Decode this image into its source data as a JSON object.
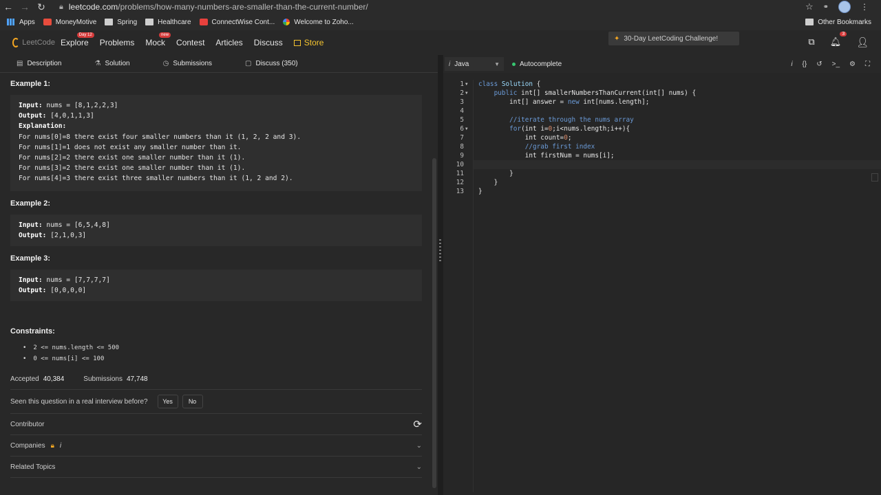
{
  "browser": {
    "url_host": "leetcode.com",
    "url_path": "/problems/how-many-numbers-are-smaller-than-the-current-number/",
    "bookmarks": [
      "Apps",
      "MoneyMotive",
      "Spring",
      "Healthcare",
      "ConnectWise Cont...",
      "Welcome to Zoho..."
    ],
    "other_bookmarks": "Other Bookmarks"
  },
  "nav": {
    "logo": "LeetCode",
    "items": [
      "Explore",
      "Problems",
      "Mock",
      "Contest",
      "Articles",
      "Discuss"
    ],
    "explore_badge": "Day 12",
    "mock_badge": "new",
    "store": "Store",
    "challenge": "30-Day LeetCoding Challenge!",
    "notif_count": "3"
  },
  "tabs": {
    "description": "Description",
    "solution": "Solution",
    "submissions": "Submissions",
    "discuss": "Discuss (350)"
  },
  "examples": [
    {
      "title": "Example 1:",
      "input_label": "Input:",
      "input": " nums = [8,1,2,2,3]",
      "output_label": "Output:",
      "output": " [4,0,1,1,3]",
      "explanation_label": "Explanation:",
      "explanation": [
        "For nums[0]=8 there exist four smaller numbers than it (1, 2, 2 and 3).",
        "For nums[1]=1 does not exist any smaller number than it.",
        "For nums[2]=2 there exist one smaller number than it (1).",
        "For nums[3]=2 there exist one smaller number than it (1).",
        "For nums[4]=3 there exist three smaller numbers than it (1, 2 and 2)."
      ]
    },
    {
      "title": "Example 2:",
      "input_label": "Input:",
      "input": " nums = [6,5,4,8]",
      "output_label": "Output:",
      "output": " [2,1,0,3]"
    },
    {
      "title": "Example 3:",
      "input_label": "Input:",
      "input": " nums = [7,7,7,7]",
      "output_label": "Output:",
      "output": " [0,0,0,0]"
    }
  ],
  "constraints": {
    "title": "Constraints:",
    "items": [
      "2 <= nums.length <= 500",
      "0 <= nums[i] <= 100"
    ]
  },
  "stats": {
    "accepted_label": "Accepted",
    "accepted_value": "40,384",
    "submissions_label": "Submissions",
    "submissions_value": "47,748"
  },
  "interview": {
    "question": "Seen this question in a real interview before?",
    "yes": "Yes",
    "no": "No"
  },
  "sections": {
    "contributor": "Contributor",
    "companies": "Companies",
    "companies_info": "i",
    "related": "Related Topics"
  },
  "editor": {
    "language": "Java",
    "language_icon": "i",
    "autocomplete": "Autocomplete",
    "tool_info": "i",
    "tool_braces": "{}",
    "tool_console": ">_"
  },
  "code": {
    "line_numbers": [
      "1",
      "2",
      "3",
      "4",
      "5",
      "6",
      "7",
      "8",
      "9",
      "10",
      "11",
      "12",
      "13"
    ],
    "l1_kw": "class",
    "l1_cls": "Solution",
    "l1_rest": " {",
    "l2_kw": "public",
    "l2_rest": " int[] smallerNumbersThanCurrent(int[] nums) {",
    "l3_a": "int[] answer = ",
    "l3_kw": "new",
    "l3_b": " int[nums.length];",
    "l5_cm": "//iterate through the nums array",
    "l6_kw": "for",
    "l6_a": "(int i=",
    "l6_n0": "0",
    "l6_b": ";i<nums.length;i++){",
    "l7_a": "int count=",
    "l7_n0": "0",
    "l7_b": ";",
    "l8_cm": "//grab first index",
    "l9": "int firstNum = nums[i];",
    "l11": "}",
    "l12": "}",
    "l13": "}"
  }
}
